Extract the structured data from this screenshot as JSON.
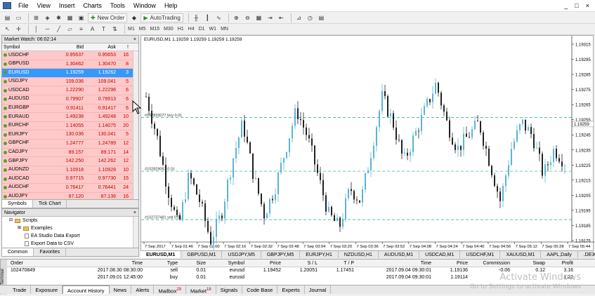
{
  "menu": {
    "items": [
      "File",
      "View",
      "Insert",
      "Charts",
      "Tools",
      "Window",
      "Help"
    ]
  },
  "window_controls": [
    "_",
    "□",
    "×"
  ],
  "toolbar": {
    "new_order": "New Order",
    "autotrading": "AutoTrading"
  },
  "timeframes": [
    "M1",
    "M5",
    "M15",
    "M30",
    "H1",
    "H4",
    "D1",
    "W1",
    "MN"
  ],
  "market_watch": {
    "title": "Market Watch: 06:02:14",
    "columns": [
      "Symbol",
      "Bid",
      "Ask",
      "!"
    ],
    "rows": [
      {
        "symbol": "USDCHF",
        "bid": "0.95637",
        "ask": "0.95653",
        "spread": "16"
      },
      {
        "symbol": "GBPUSD",
        "bid": "1.30462",
        "ask": "1.30470",
        "spread": "8"
      },
      {
        "symbol": "EURUSD",
        "bid": "1.19259",
        "ask": "1.19262",
        "spread": "3"
      },
      {
        "symbol": "USDJPY",
        "bid": "109.036",
        "ask": "109.041",
        "spread": "5"
      },
      {
        "symbol": "USDCAD",
        "bid": "1.22290",
        "ask": "1.22296",
        "spread": "6"
      },
      {
        "symbol": "AUDUSD",
        "bid": "0.79907",
        "ask": "0.79913",
        "spread": "6"
      },
      {
        "symbol": "EURGBP",
        "bid": "0.91411",
        "ask": "0.91417",
        "spread": "6"
      },
      {
        "symbol": "EURAUD",
        "bid": "1.49238",
        "ask": "1.49248",
        "spread": "10"
      },
      {
        "symbol": "EURCHF",
        "bid": "1.14055",
        "ask": "1.14075",
        "spread": "20"
      },
      {
        "symbol": "EURJPY",
        "bid": "130.036",
        "ask": "130.041",
        "spread": "5"
      },
      {
        "symbol": "GBPCHF",
        "bid": "1.24777",
        "ask": "1.24789",
        "spread": "12"
      },
      {
        "symbol": "CADJPY",
        "bid": "89.157",
        "ask": "89.171",
        "spread": "14"
      },
      {
        "symbol": "GBPJPY",
        "bid": "142.250",
        "ask": "142.262",
        "spread": "12"
      },
      {
        "symbol": "AUDNZD",
        "bid": "1.10918",
        "ask": "1.10928",
        "spread": "10"
      },
      {
        "symbol": "AUDCAD",
        "bid": "0.97715",
        "ask": "0.97730",
        "spread": "15"
      },
      {
        "symbol": "AUDCHF",
        "bid": "0.76417",
        "ask": "0.76441",
        "spread": "24"
      },
      {
        "symbol": "AUDJPY",
        "bid": "87.120",
        "ask": "87.136",
        "spread": "16"
      }
    ],
    "selected_index": 2,
    "tabs": [
      "Symbols",
      "Tick Chart"
    ]
  },
  "navigator": {
    "title": "Navigator",
    "items": [
      "Scripts",
      "Examples",
      "EA Studio Data Export",
      "Export Data to CSV"
    ],
    "tabs": [
      "Common",
      "Favorites"
    ]
  },
  "chart": {
    "title": "EURUSD,M1  1.19259 1.19259 1.19259 1.19259",
    "lines": [
      {
        "label": "#102833077 buy 0.01",
        "price": 1.19264,
        "color": "#1aa3a3"
      },
      {
        "label": "#102829067 0.01",
        "price": 1.19223,
        "color": "#1aa3a3"
      },
      {
        "label": "#102737481 sell 0.01",
        "price": 1.19186,
        "color": "#1aa3a3"
      }
    ],
    "current_price": "1.19259",
    "price_labels": [
      "1.19315",
      "1.19295",
      "1.19285",
      "1.19275",
      "1.19265",
      "1.19255",
      "1.19245",
      "1.19235",
      "1.19225",
      "1.19215",
      "1.19205",
      "1.19195",
      "1.19185",
      "1.19175"
    ],
    "time_labels": [
      "7 Sep 2017",
      "7 Sep 01:46",
      "7 Sep 02:00",
      "7 Sep 02:16",
      "7 Sep 02:32",
      "7 Sep 02:48",
      "7 Sep 03:04",
      "7 Sep 03:20",
      "7 Sep 03:36",
      "7 Sep 03:52",
      "7 Sep 04:08",
      "7 Sep 04:24",
      "7 Sep 04:40",
      "7 Sep 04:56",
      "7 Sep 05:12",
      "7 Sep 05:28",
      "7 Sep 05:44"
    ],
    "tabs": [
      "EURUSD,M1",
      "GBPUSD,M1",
      "USDJPY,M5",
      "GBPJPY,M5",
      "EURJPY,H1",
      "NZDUSD,H1",
      "AUDUSD,M1",
      "USDCAD,M1",
      "USDCHF,M1",
      "XAUUSD,M1",
      "AAPL,Daily",
      ".DE30C"
    ]
  },
  "chart_data": {
    "type": "candlestick",
    "title": "EURUSD,M1",
    "ylim": [
      1.1917,
      1.1932
    ],
    "series": [
      {
        "name": "EURUSD,M1",
        "close": [
          1.1928,
          1.1925,
          1.1921,
          1.1918,
          1.1922,
          1.192,
          1.1917,
          1.1919,
          1.1923,
          1.1926,
          1.1922,
          1.1919,
          1.1921,
          1.1924,
          1.1927,
          1.1925,
          1.1922,
          1.1919,
          1.1918,
          1.1921,
          1.192,
          1.1924,
          1.1928,
          1.1926,
          1.1923,
          1.1925,
          1.1927,
          1.1929,
          1.1926,
          1.1924,
          1.1925,
          1.1926,
          1.1923,
          1.192,
          1.1924,
          1.1926,
          1.1925,
          1.1922,
          1.1924,
          1.1923
        ]
      }
    ]
  },
  "terminal": {
    "columns": [
      "Order",
      "Time",
      "Type",
      "Size",
      "Symbol",
      "Price",
      "S / L",
      "T / P",
      "Time",
      "Price",
      "Commission",
      "Swap",
      "Profit"
    ],
    "rows": [
      [
        "102470849",
        "2017.08.30 08:30:00",
        "sell",
        "0.01",
        "eurusd",
        "1.19452",
        "1.20051",
        "1.17451",
        "2017.09.04 09:30:01",
        "1.19136",
        "-0.06",
        "0.12",
        "3.16"
      ],
      [
        "",
        "2017.09.01 12:45:00",
        "buy",
        "0.01",
        "eurusd",
        "",
        "",
        "",
        "2017.09.04 09:30:01",
        "1.19114",
        "",
        "",
        "1.22"
      ]
    ],
    "tabs": [
      "Trade",
      "Exposure",
      "Account History",
      "News",
      "Alerts",
      "Mailbox",
      "Market",
      "Signals",
      "Code Base",
      "Experts",
      "Journal"
    ],
    "mailbox_badge": "29",
    "market_badge": "18",
    "side_label": "Terminal"
  },
  "watermark": {
    "line1": "Activate Windows",
    "line2": "Go to Settings to activate Windows"
  }
}
